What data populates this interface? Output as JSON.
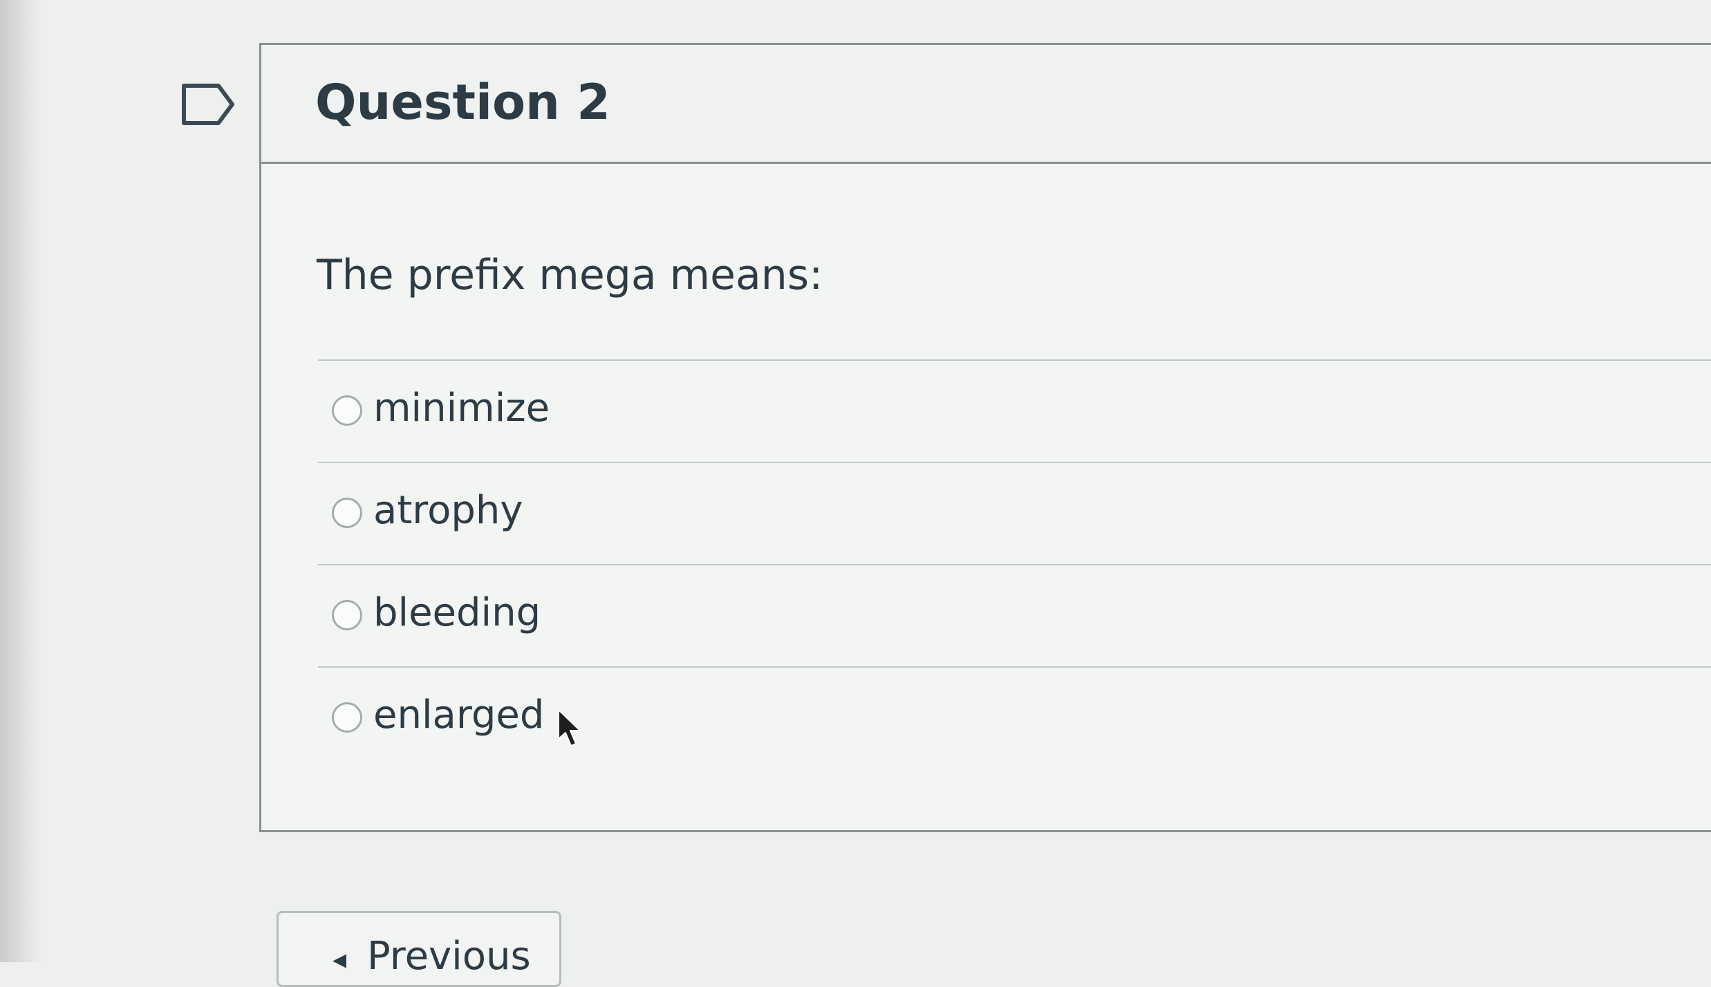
{
  "question": {
    "title": "Question 2",
    "text": "The prefix mega means:",
    "answers": [
      {
        "label": "minimize"
      },
      {
        "label": "atrophy"
      },
      {
        "label": "bleeding"
      },
      {
        "label": "enlarged"
      }
    ]
  },
  "navigation": {
    "previous_label": "Previous",
    "previous_arrow": "◂"
  },
  "icons": {
    "flag": "flag-question-icon",
    "cursor": "mouse-pointer-icon",
    "radio": "radio-button-icon"
  },
  "colors": {
    "text": "#2d3b45",
    "border": "#8c8f90",
    "background": "#eef0ee"
  }
}
